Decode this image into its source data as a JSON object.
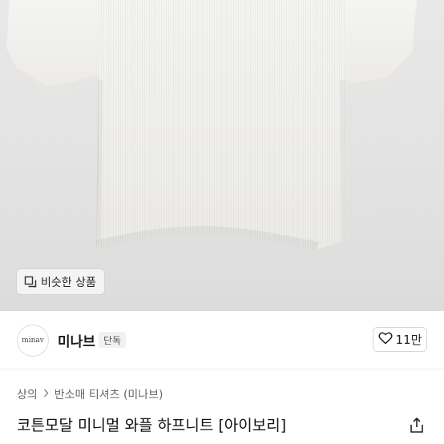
{
  "similar": {
    "label": "비슷한 상품"
  },
  "seller": {
    "avatar_text": "minav",
    "name": "미나브",
    "badge": "단독"
  },
  "likes": {
    "count": "11만"
  },
  "breadcrumb": {
    "category": "상의",
    "subcategory": "반소매 티셔츠 (미나브)"
  },
  "product": {
    "title": "코튼모달 미니멀 와플 하프니트 [아이보리]"
  },
  "icons": {
    "similar": "copy-icon",
    "like": "heart-icon",
    "chevron": "chevron-right-icon",
    "share": "share-icon"
  }
}
